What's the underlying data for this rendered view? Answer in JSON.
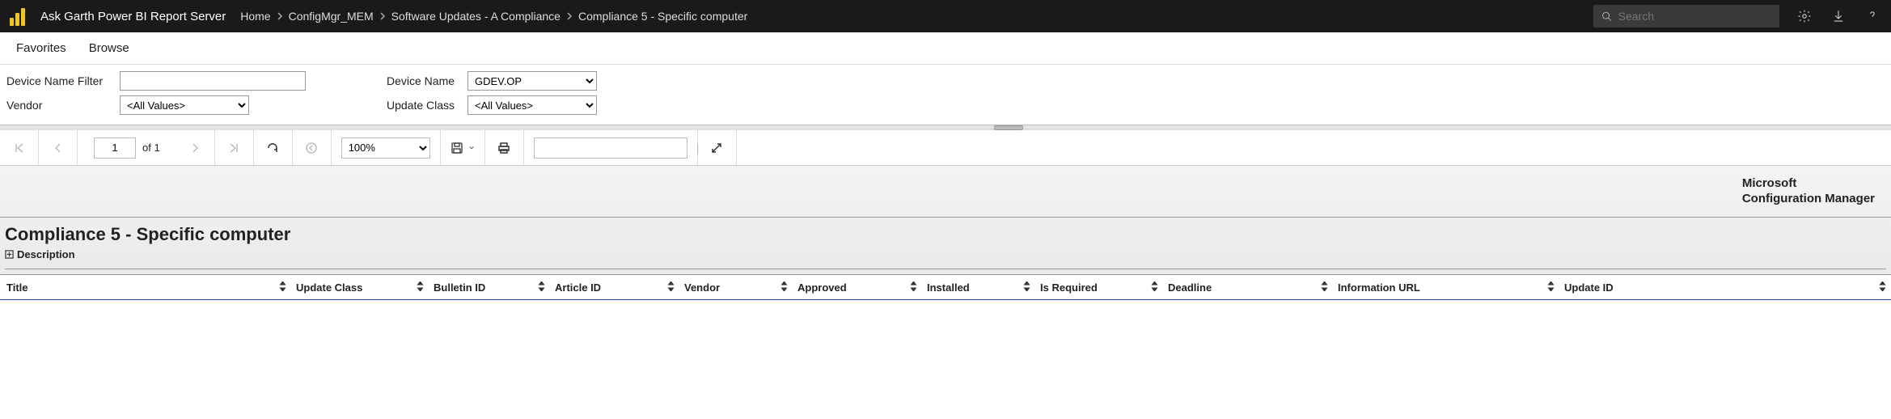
{
  "header": {
    "server_name": "Ask Garth Power BI Report Server",
    "breadcrumb": [
      "Home",
      "ConfigMgr_MEM",
      "Software Updates - A Compliance",
      "Compliance 5 - Specific computer"
    ],
    "search_placeholder": "Search"
  },
  "nav": {
    "favorites": "Favorites",
    "browse": "Browse"
  },
  "params": {
    "device_name_filter_label": "Device Name Filter",
    "device_name_filter_value": "",
    "device_name_label": "Device Name",
    "device_name_value": "GDEV.OP",
    "vendor_label": "Vendor",
    "vendor_value": "<All Values>",
    "update_class_label": "Update Class",
    "update_class_value": "<All Values>"
  },
  "toolbar": {
    "page_current": "1",
    "page_of": "of",
    "page_total": "1",
    "zoom": "100%"
  },
  "report": {
    "brand_line1": "Microsoft",
    "brand_line2": "Configuration Manager",
    "title": "Compliance 5 - Specific computer",
    "expander": "Description"
  },
  "columns": {
    "title": "Title",
    "update_class": "Update Class",
    "bulletin_id": "Bulletin ID",
    "article_id": "Article ID",
    "vendor": "Vendor",
    "approved": "Approved",
    "installed": "Installed",
    "is_required": "Is Required",
    "deadline": "Deadline",
    "information_url": "Information URL",
    "update_id": "Update ID"
  }
}
